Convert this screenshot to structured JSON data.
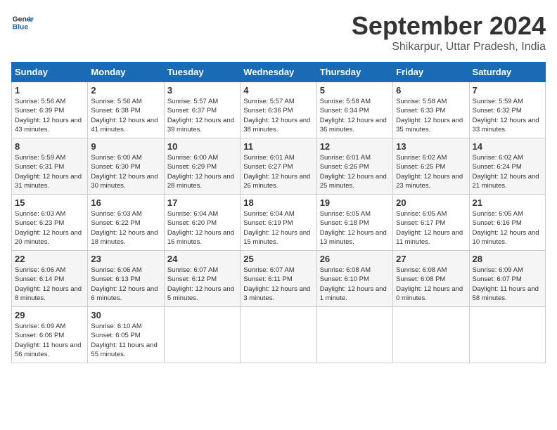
{
  "logo": {
    "line1": "General",
    "line2": "Blue"
  },
  "title": "September 2024",
  "location": "Shikarpur, Uttar Pradesh, India",
  "days_of_week": [
    "Sunday",
    "Monday",
    "Tuesday",
    "Wednesday",
    "Thursday",
    "Friday",
    "Saturday"
  ],
  "weeks": [
    [
      {
        "day": "1",
        "sunrise": "5:56 AM",
        "sunset": "6:39 PM",
        "daylight": "12 hours and 43 minutes."
      },
      {
        "day": "2",
        "sunrise": "5:56 AM",
        "sunset": "6:38 PM",
        "daylight": "12 hours and 41 minutes."
      },
      {
        "day": "3",
        "sunrise": "5:57 AM",
        "sunset": "6:37 PM",
        "daylight": "12 hours and 39 minutes."
      },
      {
        "day": "4",
        "sunrise": "5:57 AM",
        "sunset": "6:36 PM",
        "daylight": "12 hours and 38 minutes."
      },
      {
        "day": "5",
        "sunrise": "5:58 AM",
        "sunset": "6:34 PM",
        "daylight": "12 hours and 36 minutes."
      },
      {
        "day": "6",
        "sunrise": "5:58 AM",
        "sunset": "6:33 PM",
        "daylight": "12 hours and 35 minutes."
      },
      {
        "day": "7",
        "sunrise": "5:59 AM",
        "sunset": "6:32 PM",
        "daylight": "12 hours and 33 minutes."
      }
    ],
    [
      {
        "day": "8",
        "sunrise": "5:59 AM",
        "sunset": "6:31 PM",
        "daylight": "12 hours and 31 minutes."
      },
      {
        "day": "9",
        "sunrise": "6:00 AM",
        "sunset": "6:30 PM",
        "daylight": "12 hours and 30 minutes."
      },
      {
        "day": "10",
        "sunrise": "6:00 AM",
        "sunset": "6:29 PM",
        "daylight": "12 hours and 28 minutes."
      },
      {
        "day": "11",
        "sunrise": "6:01 AM",
        "sunset": "6:27 PM",
        "daylight": "12 hours and 26 minutes."
      },
      {
        "day": "12",
        "sunrise": "6:01 AM",
        "sunset": "6:26 PM",
        "daylight": "12 hours and 25 minutes."
      },
      {
        "day": "13",
        "sunrise": "6:02 AM",
        "sunset": "6:25 PM",
        "daylight": "12 hours and 23 minutes."
      },
      {
        "day": "14",
        "sunrise": "6:02 AM",
        "sunset": "6:24 PM",
        "daylight": "12 hours and 21 minutes."
      }
    ],
    [
      {
        "day": "15",
        "sunrise": "6:03 AM",
        "sunset": "6:23 PM",
        "daylight": "12 hours and 20 minutes."
      },
      {
        "day": "16",
        "sunrise": "6:03 AM",
        "sunset": "6:22 PM",
        "daylight": "12 hours and 18 minutes."
      },
      {
        "day": "17",
        "sunrise": "6:04 AM",
        "sunset": "6:20 PM",
        "daylight": "12 hours and 16 minutes."
      },
      {
        "day": "18",
        "sunrise": "6:04 AM",
        "sunset": "6:19 PM",
        "daylight": "12 hours and 15 minutes."
      },
      {
        "day": "19",
        "sunrise": "6:05 AM",
        "sunset": "6:18 PM",
        "daylight": "12 hours and 13 minutes."
      },
      {
        "day": "20",
        "sunrise": "6:05 AM",
        "sunset": "6:17 PM",
        "daylight": "12 hours and 11 minutes."
      },
      {
        "day": "21",
        "sunrise": "6:05 AM",
        "sunset": "6:16 PM",
        "daylight": "12 hours and 10 minutes."
      }
    ],
    [
      {
        "day": "22",
        "sunrise": "6:06 AM",
        "sunset": "6:14 PM",
        "daylight": "12 hours and 8 minutes."
      },
      {
        "day": "23",
        "sunrise": "6:06 AM",
        "sunset": "6:13 PM",
        "daylight": "12 hours and 6 minutes."
      },
      {
        "day": "24",
        "sunrise": "6:07 AM",
        "sunset": "6:12 PM",
        "daylight": "12 hours and 5 minutes."
      },
      {
        "day": "25",
        "sunrise": "6:07 AM",
        "sunset": "6:11 PM",
        "daylight": "12 hours and 3 minutes."
      },
      {
        "day": "26",
        "sunrise": "6:08 AM",
        "sunset": "6:10 PM",
        "daylight": "12 hours and 1 minute."
      },
      {
        "day": "27",
        "sunrise": "6:08 AM",
        "sunset": "6:08 PM",
        "daylight": "12 hours and 0 minutes."
      },
      {
        "day": "28",
        "sunrise": "6:09 AM",
        "sunset": "6:07 PM",
        "daylight": "11 hours and 58 minutes."
      }
    ],
    [
      {
        "day": "29",
        "sunrise": "6:09 AM",
        "sunset": "6:06 PM",
        "daylight": "11 hours and 56 minutes."
      },
      {
        "day": "30",
        "sunrise": "6:10 AM",
        "sunset": "6:05 PM",
        "daylight": "11 hours and 55 minutes."
      },
      null,
      null,
      null,
      null,
      null
    ]
  ],
  "labels": {
    "sunrise": "Sunrise:",
    "sunset": "Sunset:",
    "daylight": "Daylight:"
  }
}
